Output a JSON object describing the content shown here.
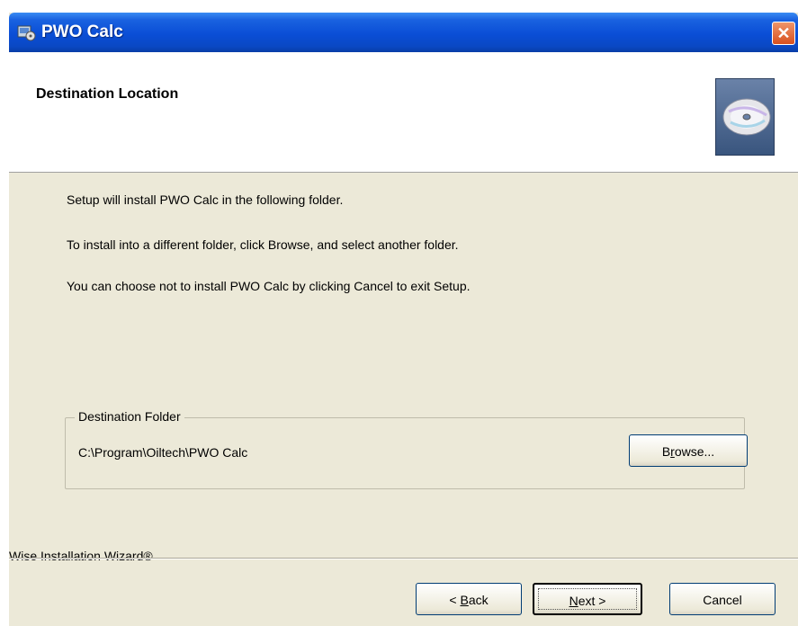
{
  "window": {
    "title": "PWO Calc",
    "close_symbol": "✕",
    "icon": "installer-icon"
  },
  "header": {
    "title": "Destination Location",
    "graphic": "cd-disc-icon"
  },
  "body": {
    "line1": "Setup will install PWO Calc in the following folder.",
    "line2": "To install into a different folder, click Browse, and select another folder.",
    "line3": "You can choose not to install PWO Calc by clicking Cancel to exit Setup."
  },
  "destination": {
    "legend": "Destination Folder",
    "path": "C:\\Program\\Oiltech\\PWO Calc",
    "browse_mnemonic": "r",
    "browse_rest_pre": "B",
    "browse_rest_post": "owse..."
  },
  "footer": {
    "brand": "Wise Installation Wizard®",
    "back_pre": "< ",
    "back_mnemonic": "B",
    "back_post": "ack",
    "next_mnemonic": "N",
    "next_post": "ext >",
    "cancel": "Cancel"
  },
  "colors": {
    "titlebar": "#0a4ed6",
    "dialog_bg": "#ece9d8",
    "close": "#d8501f"
  }
}
